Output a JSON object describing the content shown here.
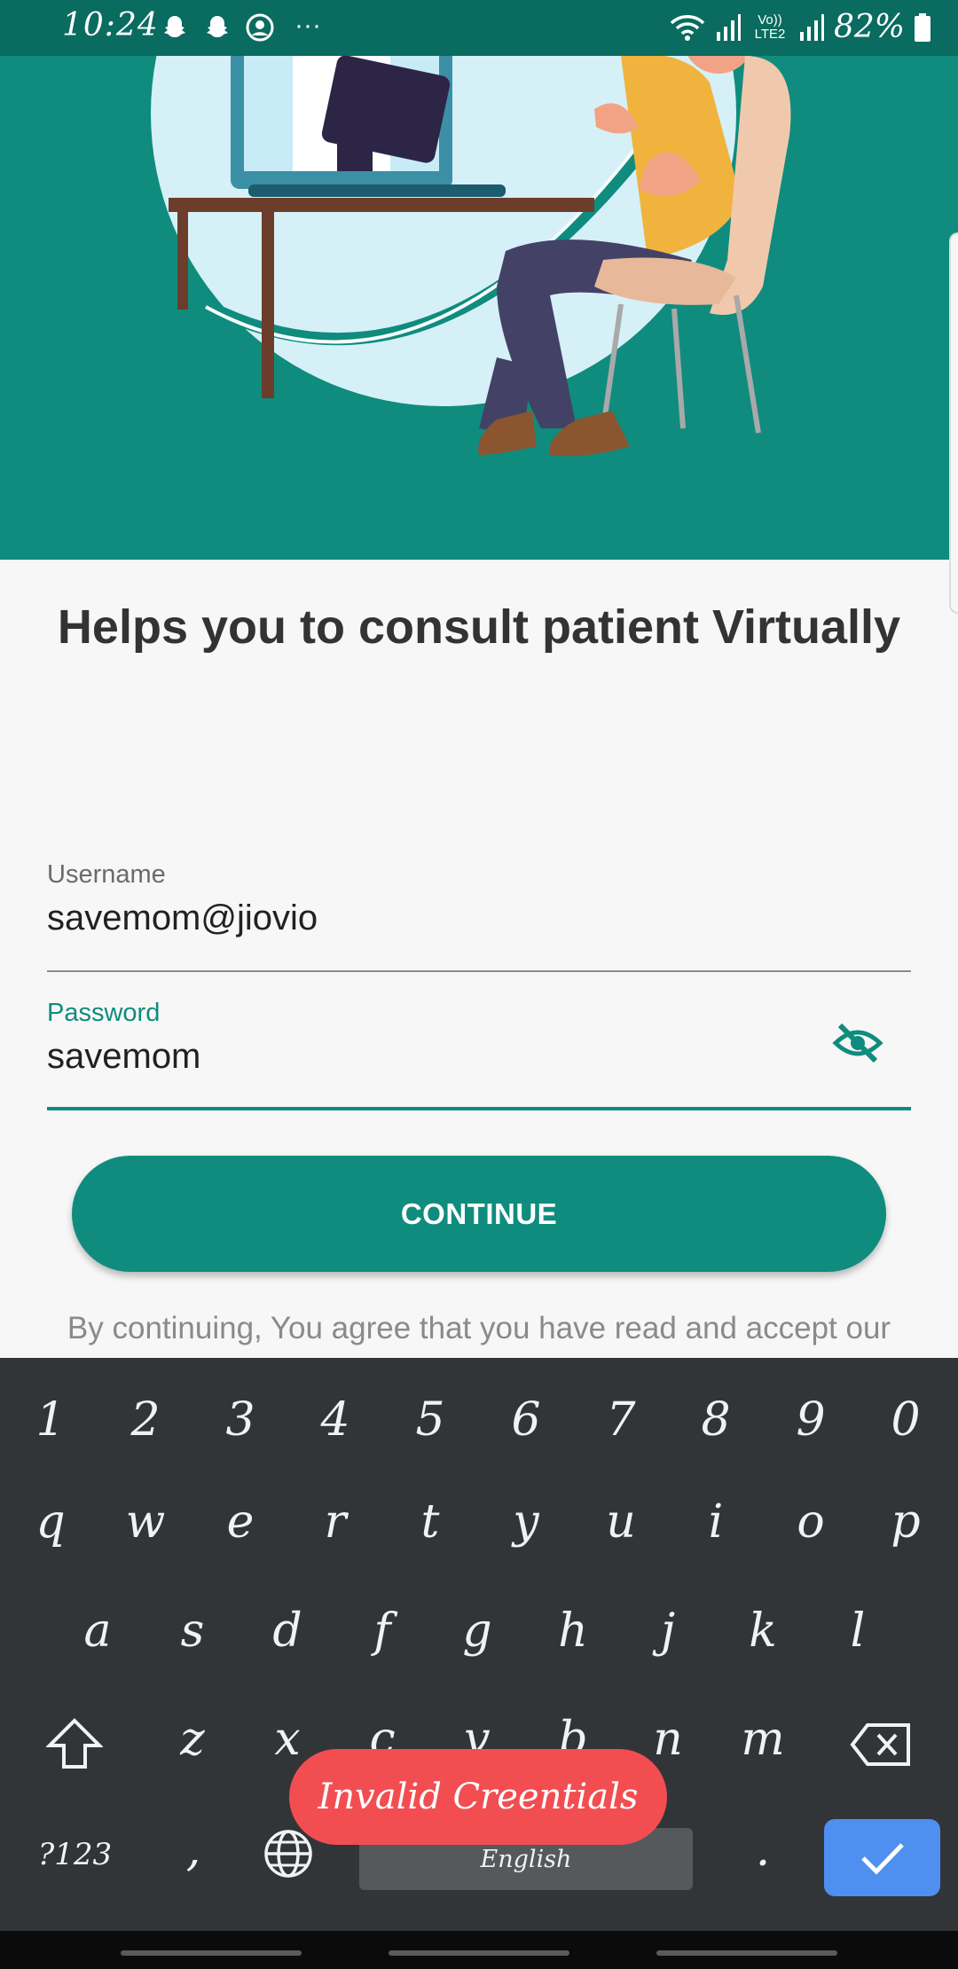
{
  "status_bar": {
    "time": "10:24",
    "more": "···",
    "network_label": "Vo)) LTE2",
    "battery": "82%"
  },
  "main": {
    "headline": "Helps you to consult patient Virtually"
  },
  "form": {
    "username_label": "Username",
    "username_value": "savemom@jiovio",
    "password_label": "Password",
    "password_value": "savemom",
    "continue_label": "CONTINUE",
    "terms_text": "By continuing, You agree that you have read and accept our"
  },
  "keyboard": {
    "row_numbers": [
      "1",
      "2",
      "3",
      "4",
      "5",
      "6",
      "7",
      "8",
      "9",
      "0"
    ],
    "row_q": [
      "q",
      "w",
      "e",
      "r",
      "t",
      "y",
      "u",
      "i",
      "o",
      "p"
    ],
    "row_a": [
      "a",
      "s",
      "d",
      "f",
      "g",
      "h",
      "j",
      "k",
      "l"
    ],
    "row_z": [
      "z",
      "x",
      "c",
      "v",
      "b",
      "n",
      "m"
    ],
    "symbols_label": "?123",
    "comma": ",",
    "period": ".",
    "space_label": "English"
  },
  "toast": {
    "message": "Invalid Creentials"
  },
  "colors": {
    "primary": "#0f8c7e",
    "status_bar": "#0a6b60",
    "keyboard_bg": "#323538",
    "toast_bg": "#f24e52",
    "enter_key": "#4f8ff0"
  }
}
